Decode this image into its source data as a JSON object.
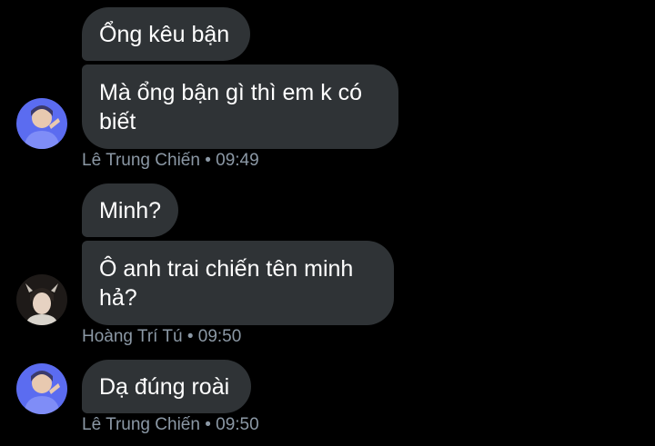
{
  "messages": [
    {
      "text": "Ổng kêu bận"
    },
    {
      "text": "Mà ổng bận gì thì em k có\nbiết"
    },
    {
      "text": "Minh?"
    },
    {
      "text": "Ô anh trai chiến tên minh\nhả?"
    },
    {
      "text": "Dạ đúng roài"
    }
  ],
  "meta": [
    {
      "sender": "Lê Trung Chiến",
      "sep": " • ",
      "time": "09:49"
    },
    {
      "sender": "Hoàng Trí Tú",
      "sep": " • ",
      "time": "09:50"
    },
    {
      "sender": "Lê Trung Chiến",
      "sep": " • ",
      "time": "09:50"
    }
  ],
  "avatars": [
    {
      "icon": "avatar-photo-blue",
      "color": "#5b6cf0"
    },
    {
      "icon": "avatar-photo-dark",
      "color": "#1e1a18"
    },
    {
      "icon": "avatar-photo-blue",
      "color": "#5b6cf0"
    }
  ],
  "colors": {
    "background": "#000000",
    "bubble": "#2f3336",
    "bubble_text": "#ffffff",
    "meta_text": "#8b98a5"
  }
}
